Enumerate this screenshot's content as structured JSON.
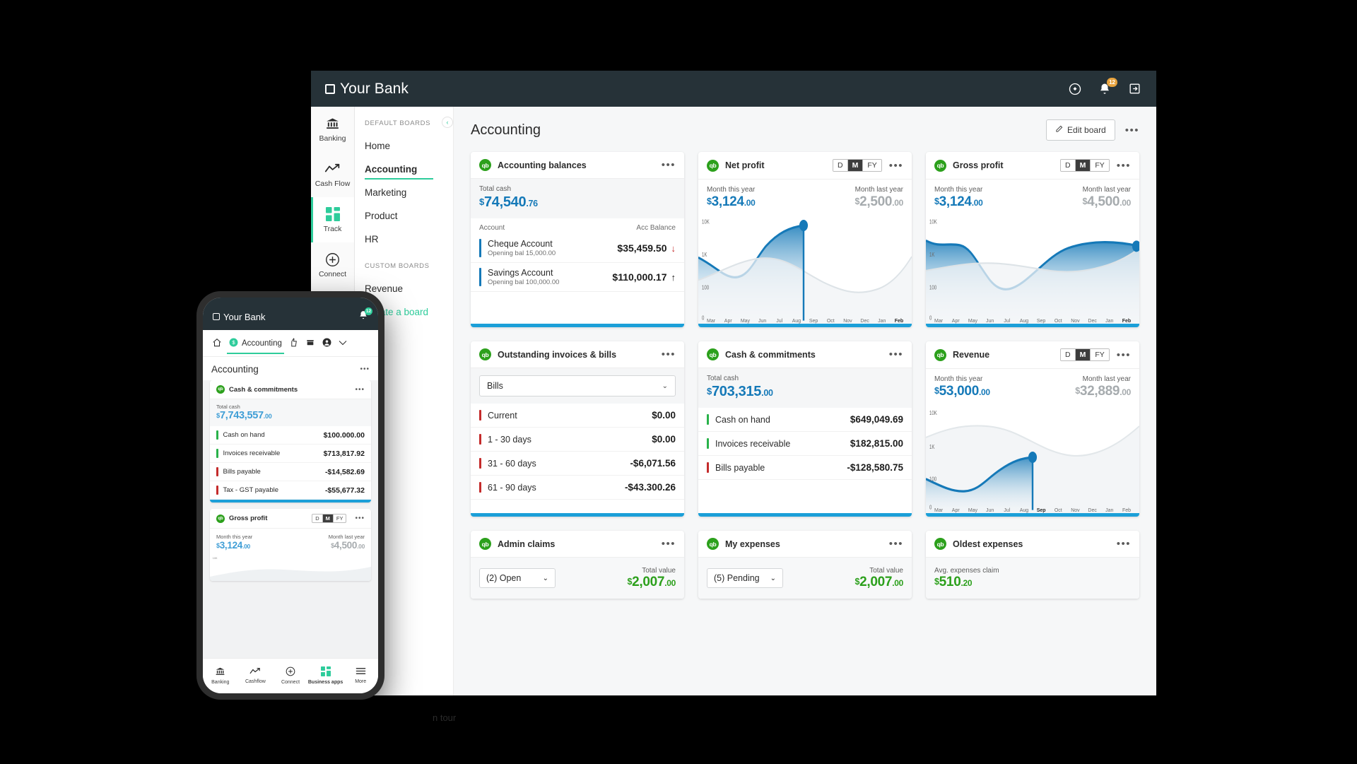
{
  "desktop": {
    "topbar": {
      "brand": "Your Bank",
      "icons": [
        {
          "name": "help-icon",
          "glyph": "?"
        },
        {
          "name": "notifications-icon",
          "glyph": "bell",
          "badge": "12"
        },
        {
          "name": "logout-icon",
          "glyph": "exit"
        }
      ]
    },
    "rail": [
      {
        "label": "Banking",
        "icon": "bank-icon",
        "active": false
      },
      {
        "label": "Cash Flow",
        "icon": "trend-line-icon",
        "active": false
      },
      {
        "label": "Track",
        "icon": "grid-squares-icon",
        "active": true
      },
      {
        "label": "Connect",
        "icon": "plus-circle-icon",
        "active": false
      }
    ],
    "boards": {
      "default_header": "DEFAULT BOARDS",
      "default_items": [
        "Home",
        "Accounting",
        "Marketing",
        "Product",
        "HR"
      ],
      "active_item": "Accounting",
      "custom_header": "CUSTOM BOARDS",
      "custom_items": [
        "Revenue"
      ],
      "create_label": "Create a board",
      "collapse_icon": "chevron-left-icon"
    },
    "header": {
      "title": "Accounting",
      "edit_board_label": "Edit board",
      "edit_icon": "pencil-icon",
      "more_icon": "more-options-icon"
    },
    "cards": {
      "accounting_balances": {
        "title": "Accounting balances",
        "total_label": "Total cash",
        "total_cur": "$",
        "total_main": "74,540",
        "total_cents": ".76",
        "col_left": "Account",
        "col_right": "Acc Balance",
        "rows": [
          {
            "name": "Cheque Account",
            "sub": "Opening bal 15,000.00",
            "value": "$35,459.50",
            "arrow": "down",
            "tick": "blue"
          },
          {
            "name": "Savings Account",
            "sub": "Opening bal 100,000.00",
            "value": "$110,000.17",
            "arrow": "up",
            "tick": "blue"
          }
        ]
      },
      "net_profit": {
        "title": "Net profit",
        "segments": [
          "D",
          "M",
          "FY"
        ],
        "segment_active": "M",
        "this_label": "Month this year",
        "this_cur": "$",
        "this_main": "3,124",
        "this_cents": ".00",
        "last_label": "Month last year",
        "last_cur": "$",
        "last_main": "2,500",
        "last_cents": ".00"
      },
      "gross_profit": {
        "title": "Gross profit",
        "segments": [
          "D",
          "M",
          "FY"
        ],
        "segment_active": "M",
        "this_label": "Month this year",
        "this_cur": "$",
        "this_main": "3,124",
        "this_cents": ".00",
        "last_label": "Month last year",
        "last_cur": "$",
        "last_main": "4,500",
        "last_cents": ".00"
      },
      "outstanding": {
        "title": "Outstanding invoices & bills",
        "select_value": "Bills",
        "rows": [
          {
            "label": "Current",
            "value": "$0.00"
          },
          {
            "label": "1 - 30 days",
            "value": "$0.00"
          },
          {
            "label": "31 - 60 days",
            "value": "-$6,071.56"
          },
          {
            "label": "61 - 90 days",
            "value": "-$43.300.26"
          }
        ]
      },
      "cash_commitments": {
        "title": "Cash & commitments",
        "total_label": "Total cash",
        "total_cur": "$",
        "total_main": "703,315",
        "total_cents": ".00",
        "rows": [
          {
            "label": "Cash on hand",
            "value": "$649,049.69",
            "tick": "green"
          },
          {
            "label": "Invoices receivable",
            "value": "$182,815.00",
            "tick": "green"
          },
          {
            "label": "Bills payable",
            "value": "-$128,580.75",
            "tick": "red"
          }
        ]
      },
      "revenue": {
        "title": "Revenue",
        "segments": [
          "D",
          "M",
          "FY"
        ],
        "segment_active": "M",
        "this_label": "Month this year",
        "this_cur": "$",
        "this_main": "53,000",
        "this_cents": ".00",
        "last_label": "Month last year",
        "last_cur": "$",
        "last_main": "32,889",
        "last_cents": ".00"
      },
      "admin_claims": {
        "title": "Admin claims",
        "select_value": "(2) Open",
        "total_label": "Total value",
        "total_cur": "$",
        "total_main": "2,007",
        "total_cents": ".00"
      },
      "my_expenses": {
        "title": "My expenses",
        "select_value": "(5) Pending",
        "total_label": "Total value",
        "total_cur": "$",
        "total_main": "2,007",
        "total_cents": ".00"
      },
      "oldest_expenses": {
        "title": "Oldest expenses",
        "avg_label": "Avg. expenses claim",
        "avg_cur": "$",
        "avg_main": "510",
        "avg_cents": ".20"
      }
    }
  },
  "chart_data": [
    {
      "type": "line",
      "title": "Net profit",
      "x": [
        "Mar",
        "Apr",
        "May",
        "Jun",
        "Jul",
        "Aug",
        "Sep",
        "Oct",
        "Nov",
        "Dec",
        "Jan",
        "Feb"
      ],
      "ylabel": "",
      "xlabel": "",
      "ytick_labels": [
        "10K",
        "1K",
        "100",
        "0"
      ],
      "ylim": [
        0,
        10000
      ],
      "current_marker": "Sep",
      "series": [
        {
          "name": "This year",
          "values": [
            1000,
            520,
            420,
            560,
            1800,
            4200,
            6400,
            null,
            null,
            null,
            null,
            null
          ]
        },
        {
          "name": "Last year",
          "values": [
            260,
            420,
            700,
            1050,
            1150,
            980,
            700,
            430,
            330,
            420,
            900,
            2600
          ]
        }
      ]
    },
    {
      "type": "line",
      "title": "Gross profit",
      "x": [
        "Mar",
        "Apr",
        "May",
        "Jun",
        "Jul",
        "Aug",
        "Sep",
        "Oct",
        "Nov",
        "Dec",
        "Jan",
        "Feb"
      ],
      "ytick_labels": [
        "10K",
        "1K",
        "100",
        "0"
      ],
      "ylim": [
        0,
        10000
      ],
      "current_marker": "Feb",
      "series": [
        {
          "name": "This year",
          "values": [
            2900,
            2400,
            2650,
            2500,
            1500,
            900,
            1200,
            2100,
            2700,
            3000,
            3300,
            3600
          ]
        },
        {
          "name": "Last year",
          "values": [
            1500,
            1600,
            1700,
            1750,
            1700,
            1600,
            1500,
            1450,
            1500,
            1700,
            2100,
            2500
          ]
        }
      ]
    },
    {
      "type": "line",
      "title": "Revenue",
      "x": [
        "Mar",
        "Apr",
        "May",
        "Jun",
        "Jul",
        "Aug",
        "Sep",
        "Oct",
        "Nov",
        "Dec",
        "Jan",
        "Feb"
      ],
      "ytick_labels": [
        "10K",
        "1K",
        "100",
        "0"
      ],
      "ylim": [
        0,
        10000
      ],
      "current_marker": "Sep",
      "series": [
        {
          "name": "This year",
          "values": [
            130,
            80,
            60,
            90,
            300,
            700,
            1000,
            null,
            null,
            null,
            null,
            null
          ]
        },
        {
          "name": "Last year",
          "values": [
            3900,
            4600,
            5100,
            5400,
            5200,
            4300,
            3400,
            3200,
            3300,
            3900,
            5000,
            6400
          ]
        }
      ]
    }
  ],
  "phone": {
    "topbar": {
      "brand": "Your Bank",
      "bell_icon": "bell-icon",
      "badge": "12"
    },
    "tabs": [
      {
        "label": "",
        "icon": "home-icon",
        "active": false
      },
      {
        "label": "Accounting",
        "icon": "coin-icon",
        "active": true
      },
      {
        "label": "",
        "icon": "thumbs-up-icon",
        "active": false
      },
      {
        "label": "",
        "icon": "store-icon",
        "active": false
      },
      {
        "label": "",
        "icon": "account-icon",
        "active": false
      },
      {
        "label": "",
        "icon": "chevron-down-icon",
        "active": false
      }
    ],
    "page_title": "Accounting",
    "more_icon": "more-options-icon",
    "cash_card": {
      "title": "Cash & commitments",
      "total_label": "Total cash",
      "total_cur": "$",
      "total_main": "7,743,557",
      "total_cents": ".00",
      "rows": [
        {
          "label": "Cash on hand",
          "value": "$100.000.00",
          "tick": "green"
        },
        {
          "label": "Invoices receivable",
          "value": "$713,817.92",
          "tick": "green"
        },
        {
          "label": "Bills payable",
          "value": "-$14,582.69",
          "tick": "red"
        },
        {
          "label": "Tax - GST payable",
          "value": "-$55,677.32",
          "tick": "red"
        }
      ]
    },
    "gross_card": {
      "title": "Gross profit",
      "segments": [
        "D",
        "M",
        "FY"
      ],
      "segment_active": "M",
      "this_label": "Month this year",
      "this_cur": "$",
      "this_main": "3,124",
      "this_cents": ".00",
      "last_label": "Month last year",
      "last_cur": "$",
      "last_main": "4,500",
      "last_cents": ".00",
      "ytick": "10K"
    },
    "nav": [
      {
        "label": "Banking",
        "icon": "bank-icon",
        "active": false
      },
      {
        "label": "Cashflow",
        "icon": "trend-line-icon",
        "active": false
      },
      {
        "label": "Connect",
        "icon": "plus-circle-icon",
        "active": false
      },
      {
        "label": "Business apps",
        "icon": "grid-squares-icon",
        "active": true
      },
      {
        "label": "More",
        "icon": "hamburger-icon",
        "active": false
      }
    ]
  },
  "tour_text": "n tour"
}
